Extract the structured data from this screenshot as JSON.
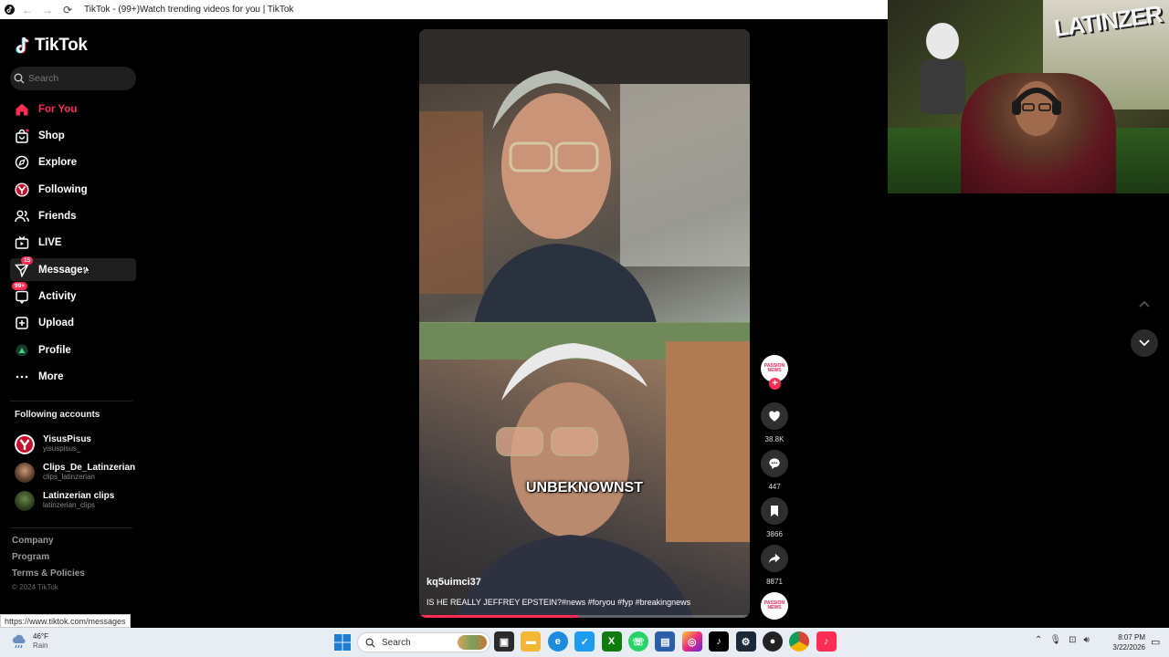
{
  "browser": {
    "tab_title": "TikTok - (99+)Watch trending videos for you | TikTok"
  },
  "sidebar": {
    "logo_text": "TikTok",
    "search_placeholder": "Search",
    "nav": [
      {
        "label": "For You",
        "icon": "home-icon",
        "active": true
      },
      {
        "label": "Shop",
        "icon": "shop-bag-icon"
      },
      {
        "label": "Explore",
        "icon": "compass-icon"
      },
      {
        "label": "Following",
        "icon": "following-avatar-icon"
      },
      {
        "label": "Friends",
        "icon": "friends-icon"
      },
      {
        "label": "LIVE",
        "icon": "live-tv-icon"
      },
      {
        "label": "Messages",
        "icon": "messages-icon",
        "badge": "15"
      },
      {
        "label": "Activity",
        "icon": "activity-icon",
        "badge": "99+"
      },
      {
        "label": "Upload",
        "icon": "upload-icon"
      },
      {
        "label": "Profile",
        "icon": "profile-icon"
      },
      {
        "label": "More",
        "icon": "more-dots-icon"
      }
    ],
    "following_title": "Following accounts",
    "accounts": [
      {
        "name": "YisusPisus",
        "handle": "yisuspisus_"
      },
      {
        "name": "Clips_De_Latinzerian",
        "handle": "clips_latinzerian"
      },
      {
        "name": "Latinzerian clips",
        "handle": "latinzerian_clips"
      }
    ],
    "footer": {
      "links": [
        "Company",
        "Program",
        "Terms & Policies"
      ],
      "copyright": "© 2024 TikTok"
    }
  },
  "video": {
    "overlay_caption": "UNBEKNOWNST",
    "author": "kq5uimci37",
    "description": "IS HE REALLY JEFFREY EPSTEIN?#news #foryou #fyp #breakingnews",
    "progress": 0.48
  },
  "actions": {
    "creator_avatar_text": "PASSION NEWS",
    "follow_symbol": "+",
    "likes": "38.8K",
    "comments": "447",
    "saves": "3866",
    "shares": "8871",
    "sound_avatar_text": "PASSION NEWS"
  },
  "status_url": "https://www.tiktok.com/messages",
  "webcam": {
    "graffiti_text": "LATINZER"
  },
  "taskbar": {
    "weather_temp": "46°F",
    "weather_desc": "Rain",
    "search_label": "Search",
    "time": "8:07 PM",
    "date": "3/22/2026"
  },
  "colors": {
    "accent": "#fe2c55",
    "sidebar_bg": "#000000",
    "taskbar_bg": "#e8edf3"
  }
}
